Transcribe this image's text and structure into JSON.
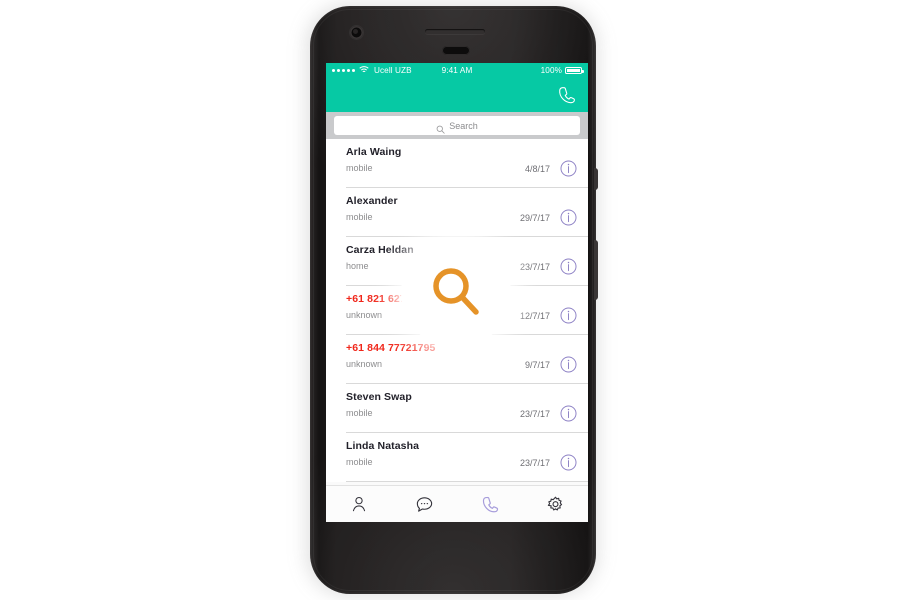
{
  "device": {
    "name": "smartphone-mockup"
  },
  "colors": {
    "green": "#06c9a4",
    "red": "#f0261a",
    "purple": "#8b7fc4",
    "orange": "#e59328",
    "search_band": "#c9cacc"
  },
  "status_bar": {
    "signal_dots": 5,
    "wifi_icon": "wifi-icon",
    "carrier": "Ucell UZB",
    "time": "9:41 AM",
    "battery_percent": "100%",
    "battery_icon": "battery-full-icon"
  },
  "navbar": {
    "call_icon": "phone-handset-icon"
  },
  "search": {
    "placeholder": "Search",
    "value": "",
    "icon": "search-icon"
  },
  "call_list": [
    {
      "name": "Arla Waing",
      "type": "mobile",
      "date": "4/8/17",
      "unknown": false,
      "info_icon": "info-circle-icon"
    },
    {
      "name": "Alexander",
      "type": "mobile",
      "date": "29/7/17",
      "unknown": false,
      "info_icon": "info-circle-icon"
    },
    {
      "name": "Carza Heldan",
      "type": "home",
      "date": "23/7/17",
      "unknown": false,
      "info_icon": "info-circle-icon"
    },
    {
      "name": "+61 821 627836",
      "type": "unknown",
      "date": "12/7/17",
      "unknown": true,
      "info_icon": "info-circle-icon"
    },
    {
      "name": "+61 844 77721795",
      "type": "unknown",
      "date": "9/7/17",
      "unknown": true,
      "info_icon": "info-circle-icon"
    },
    {
      "name": "Steven Swap",
      "type": "mobile",
      "date": "23/7/17",
      "unknown": false,
      "info_icon": "info-circle-icon"
    },
    {
      "name": "Linda Natasha",
      "type": "mobile",
      "date": "23/7/17",
      "unknown": false,
      "info_icon": "info-circle-icon"
    }
  ],
  "tabbar": [
    {
      "id": "contacts",
      "icon": "person-icon",
      "active": false
    },
    {
      "id": "messages",
      "icon": "chat-bubble-icon",
      "active": false
    },
    {
      "id": "calls",
      "icon": "phone-handset-icon",
      "active": true
    },
    {
      "id": "settings",
      "icon": "gear-icon",
      "active": false
    }
  ],
  "overlay": {
    "icon": "magnifier-icon",
    "color": "#e59328"
  }
}
